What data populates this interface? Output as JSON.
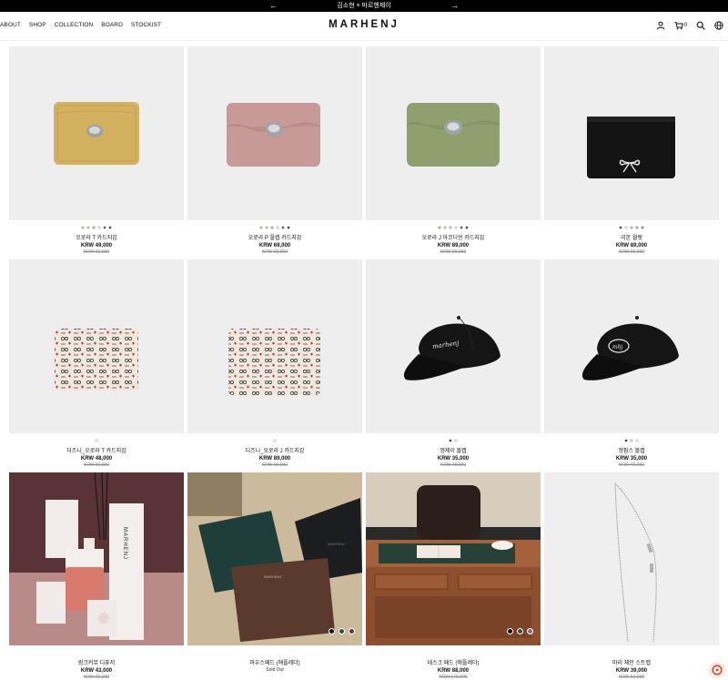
{
  "announcement": {
    "text": "김소현 × 마르헨제이",
    "prev": "←",
    "next": "→"
  },
  "nav": [
    "ABOUT",
    "SHOP",
    "COLLECTION",
    "BOARD",
    "STOCKIST"
  ],
  "brand": "MARHENJ",
  "cart_count": "0",
  "icons": [
    "user-icon",
    "cart-icon",
    "search-icon",
    "globe-icon"
  ],
  "products": [
    {
      "name": "오로라 T 카드지갑",
      "price": "KRW 49,000",
      "orig": "KRW 60,000",
      "swatches": [
        "#bf9a6a",
        "#cf9c98",
        "#8c8c7a",
        "#e6e4d4",
        "#333333",
        "#111111"
      ]
    },
    {
      "name": "오로라 P 플랩 카드지갑",
      "price": "KRW 69,000",
      "orig": "KRW 82,000",
      "swatches": [
        "#c59c6e",
        "#c9a2a0",
        "#8f997e",
        "#e6e4d4",
        "#333333",
        "#111111"
      ]
    },
    {
      "name": "오로라 J 아코디언 카드지갑",
      "price": "KRW 89,000",
      "orig": "KRW 99,000",
      "swatches": [
        "#8c9970",
        "#c8a371",
        "#cfa1a0",
        "#e6e4d4",
        "#333333",
        "#111111"
      ]
    },
    {
      "name": "리본 월렛",
      "price": "KRW 89,000",
      "orig": "KRW 99,000",
      "swatches": [
        "#111111",
        "#d6dde4",
        "#99a9b7",
        "#9c8a6a",
        "#8a5a3e"
      ]
    },
    {
      "name": "디즈니_오로라 T 카드지갑",
      "price": "KRW 48,000",
      "orig": "KRW 60,000",
      "swatches": [
        "#eeeeee"
      ]
    },
    {
      "name": "디즈니_오로라 J 카드지갑",
      "price": "KRW 89,000",
      "orig": "KRW 99,000",
      "swatches": [
        "#eeeeee"
      ]
    },
    {
      "name": "엠제이 볼캡",
      "price": "KRW 35,000",
      "orig": "KRW 45,000",
      "swatches": [
        "#111111",
        "#dddddd"
      ]
    },
    {
      "name": "엠핍스 볼캡",
      "price": "KRW 35,000",
      "orig": "KRW 45,000",
      "swatches": [
        "#111111",
        "#b7c1cc",
        "#e5dfc9"
      ]
    },
    {
      "name": "링크커뮤 디퓨저",
      "price": "KRW 43,000",
      "orig": "KRW 60,000",
      "swatches": []
    },
    {
      "name": "마우스패드 (애플레더)",
      "price": "Sold Out",
      "orig": "",
      "swatches": []
    },
    {
      "name": "데스크 패드 (애플레더)",
      "price": "KRW 88,000",
      "orig": "KRW 176,000",
      "swatches": []
    },
    {
      "name": "마리 체인 스트랩",
      "price": "KRW 39,000",
      "orig": "KRW 50,000",
      "swatches": []
    }
  ],
  "overlay_swatches": {
    "mousepad": [
      "#111111",
      "#2f5147",
      "#5a3a2c"
    ],
    "deskpad": [
      "#111111",
      "#2f5147",
      "#8a6a7a"
    ]
  }
}
